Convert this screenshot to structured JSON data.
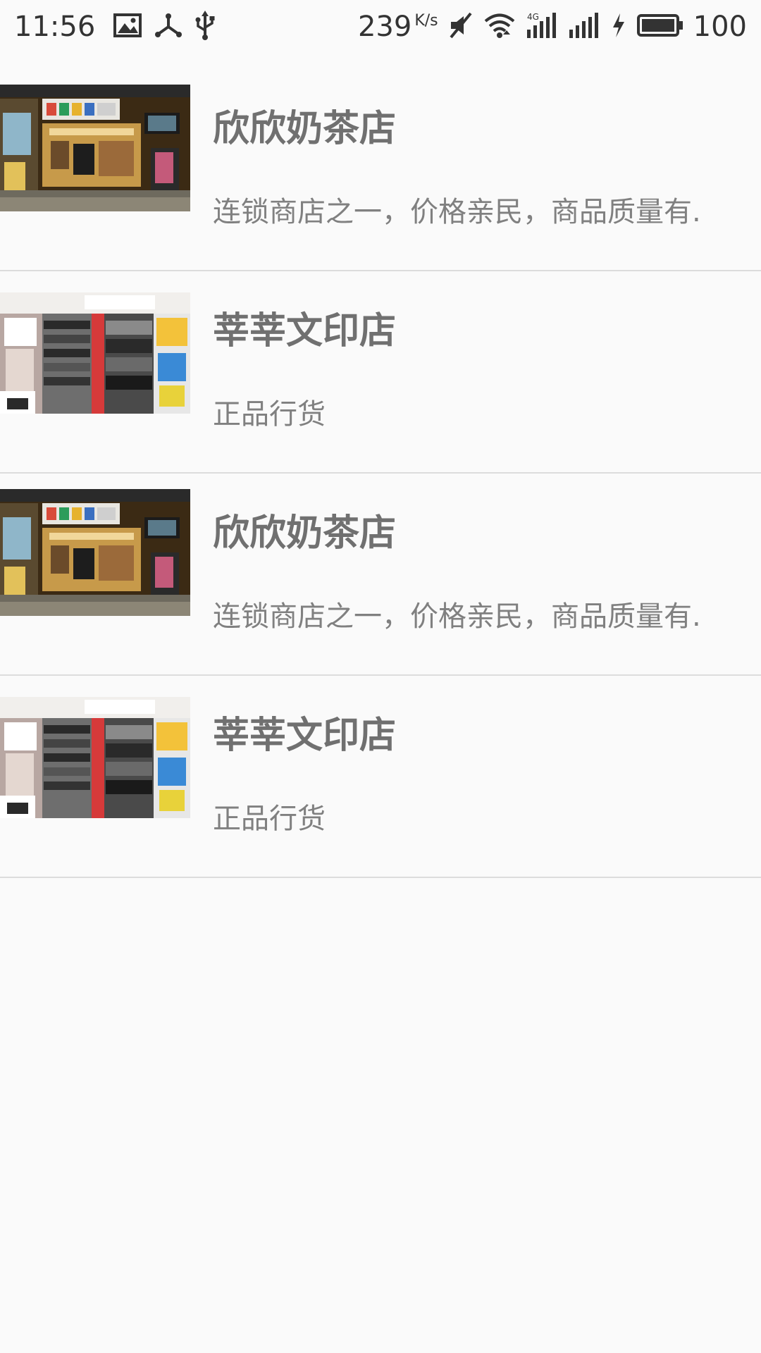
{
  "status_bar": {
    "time": "11:56",
    "net_speed": "239",
    "net_speed_unit": "K/s",
    "battery": "100",
    "icons": [
      "image-icon",
      "share-icon",
      "usb-icon",
      "mute-icon",
      "wifi-icon",
      "4g-signal-icon",
      "signal-icon",
      "charging-icon",
      "battery-icon"
    ]
  },
  "shops": [
    {
      "name": "欣欣奶茶店",
      "desc": "连锁商店之一，价格亲民，商品质量有.",
      "thumb": "milk-tea-shop-photo"
    },
    {
      "name": "莘莘文印店",
      "desc": "正品行货",
      "thumb": "stationery-shop-photo"
    },
    {
      "name": "欣欣奶茶店",
      "desc": "连锁商店之一，价格亲民，商品质量有.",
      "thumb": "milk-tea-shop-photo"
    },
    {
      "name": "莘莘文印店",
      "desc": "正品行货",
      "thumb": "stationery-shop-photo"
    }
  ]
}
